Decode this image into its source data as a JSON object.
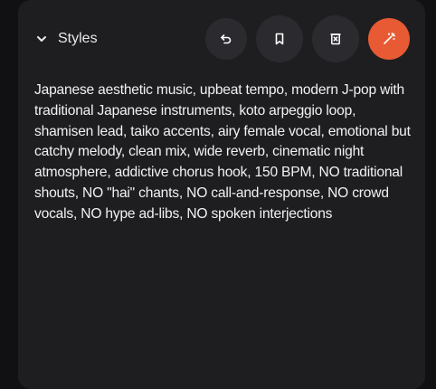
{
  "styles_panel": {
    "title": "Styles",
    "prompt_text": "Japanese aesthetic music, upbeat tempo, modern J-pop with traditional Japanese instruments, koto arpeggio loop, shamisen lead, taiko accents, airy female vocal, emotional but catchy melody, clean mix, wide reverb, cinematic night atmosphere, addictive chorus hook, 150 BPM, NO traditional shouts, NO \"hai\" chants, NO call-and-response, NO crowd vocals, NO hype ad-libs, NO spoken interjections",
    "actions": [
      {
        "name": "undo",
        "icon": "undo-icon"
      },
      {
        "name": "bookmark",
        "icon": "bookmark-icon"
      },
      {
        "name": "clear",
        "icon": "trash-icon"
      },
      {
        "name": "enhance",
        "icon": "magic-wand-icon",
        "accent": "#e75a33"
      }
    ]
  },
  "colors": {
    "background": "#111113",
    "panel": "#1e1e21",
    "button": "#2b2b2f",
    "accent": "#e75a33",
    "text": "#f2f2f4"
  }
}
